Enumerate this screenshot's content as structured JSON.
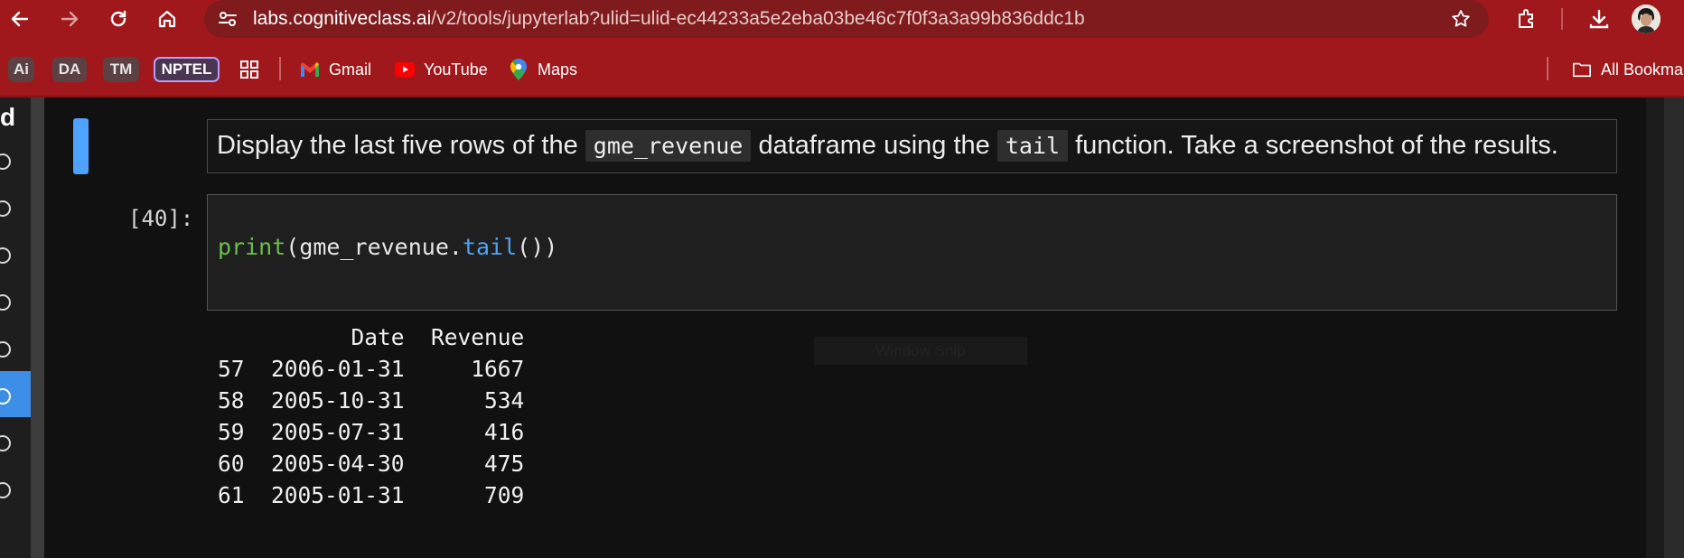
{
  "browser": {
    "url_host": "labs.cognitiveclass.ai",
    "url_path": "/v2/tools/jupyterlab?ulid=ulid-ec44233a5e2eba03be46c7f0f3a3a99b836ddc1b",
    "icons": [
      "back-arrow-icon",
      "forward-arrow-icon",
      "reload-icon",
      "home-icon",
      "site-info-icon",
      "star-icon",
      "extensions-icon",
      "download-icon",
      "avatar"
    ]
  },
  "bookmarks": {
    "chips": [
      "Ai",
      "DA",
      "TM",
      "NPTEL"
    ],
    "gmail": "Gmail",
    "youtube": "YouTube",
    "maps": "Maps",
    "all_bookmarks": "All Bookma"
  },
  "sidebar": {
    "letter": "d"
  },
  "markdown": {
    "before": "Display the last five rows of the",
    "code1": "gme_revenue",
    "middle": "dataframe using the",
    "code2": "tail",
    "after": "function. Take a screenshot of the results."
  },
  "code_cell": {
    "prompt": "[40]:",
    "fn": "print",
    "arg_open": "(gme_revenue.",
    "method": "tail",
    "arg_close": "())"
  },
  "output": {
    "header": "          Date  Revenue",
    "rows": [
      "57  2006-01-31     1667",
      "58  2005-10-31      534",
      "59  2005-07-31      416",
      "60  2005-04-30      475",
      "61  2005-01-31      709"
    ]
  },
  "overlay": {
    "snip_text": "Window Snip"
  },
  "colors": {
    "chrome": "#a0181c",
    "omnibox": "#7f1b1d",
    "accent": "#4da3ff",
    "print": "#6cbf4b",
    "method": "#4fa3f0"
  }
}
